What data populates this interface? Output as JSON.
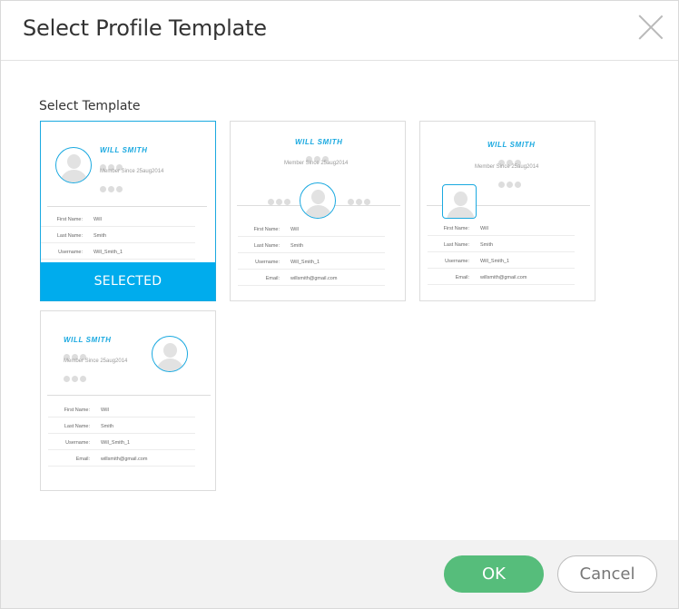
{
  "dialog": {
    "title": "Select Profile Template",
    "section_label": "Select Template"
  },
  "profile": {
    "name": "WILL SMITH",
    "member_since": "Member Since 25aug2014",
    "first_name_key": "First Name:",
    "first_name_value": "Will",
    "last_name_key": "Last Name:",
    "last_name_value": "Smith",
    "username_key": "Username:",
    "username_value": "Will_Smith_1",
    "email_key": "Email:",
    "email_value": "willsmith@gmail.com"
  },
  "selection": {
    "selected_label": "SELECTED"
  },
  "footer": {
    "ok_label": "OK",
    "cancel_label": "Cancel"
  },
  "colors": {
    "accent": "#00aced",
    "ok_button": "#56bd7b"
  }
}
